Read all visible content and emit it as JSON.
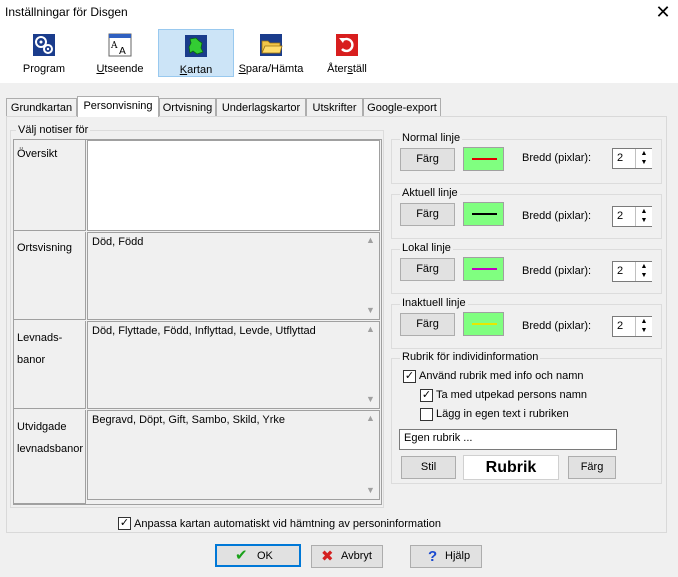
{
  "window": {
    "title": "Inställningar för Disgen"
  },
  "toolbar": {
    "program": "Program",
    "utseende": "Utseende",
    "kartan": "Kartan",
    "spara": "Spara/Hämta",
    "aterstall": "Återställ"
  },
  "tabs": [
    "Grundkartan",
    "Personvisning",
    "Ortvisning",
    "Underlagskartor",
    "Utskrifter",
    "Google-export"
  ],
  "left": {
    "group_label": "Välj notiser för",
    "rows": [
      {
        "label": "Översikt",
        "value": ""
      },
      {
        "label": "Ortsvisning",
        "value": "Död, Född"
      },
      {
        "label_line1": "Levnads-",
        "label_line2": "banor",
        "value": "Död, Flyttade, Född, Inflyttad, Levde, Utflyttad"
      },
      {
        "label_line1": "Utvidgade",
        "label_line2": "levnadsbanor",
        "value": "Begravd, Döpt, Gift, Sambo, Skild, Yrke"
      }
    ]
  },
  "lines": [
    {
      "title": "Normal linje",
      "btn": "Färg",
      "width_label": "Bredd (pixlar):",
      "width": "2",
      "color": "#e00000"
    },
    {
      "title": "Aktuell linje",
      "btn": "Färg",
      "width_label": "Bredd (pixlar):",
      "width": "2",
      "color": "#000000"
    },
    {
      "title": "Lokal linje",
      "btn": "Färg",
      "width_label": "Bredd (pixlar):",
      "width": "2",
      "color": "#c000c0"
    },
    {
      "title": "Inaktuell linje",
      "btn": "Färg",
      "width_label": "Bredd (pixlar):",
      "width": "2",
      "color": "#e8e800"
    }
  ],
  "rubrik": {
    "title": "Rubrik för individinformation",
    "chk1": "Använd rubrik med info och namn",
    "chk2": "Ta med utpekad persons namn",
    "chk3": "Lägg in egen text i rubriken",
    "input": "Egen rubrik ...",
    "stil": "Stil",
    "preview": "Rubrik",
    "farg": "Färg"
  },
  "auto": {
    "label": "Anpassa kartan automatiskt vid hämtning av personinformation"
  },
  "buttons": {
    "ok": "OK",
    "avbryt": "Avbryt",
    "hjalp": "Hjälp"
  },
  "colors": {
    "swatch_bg": "#80ff80",
    "accent": "#0078d7"
  }
}
